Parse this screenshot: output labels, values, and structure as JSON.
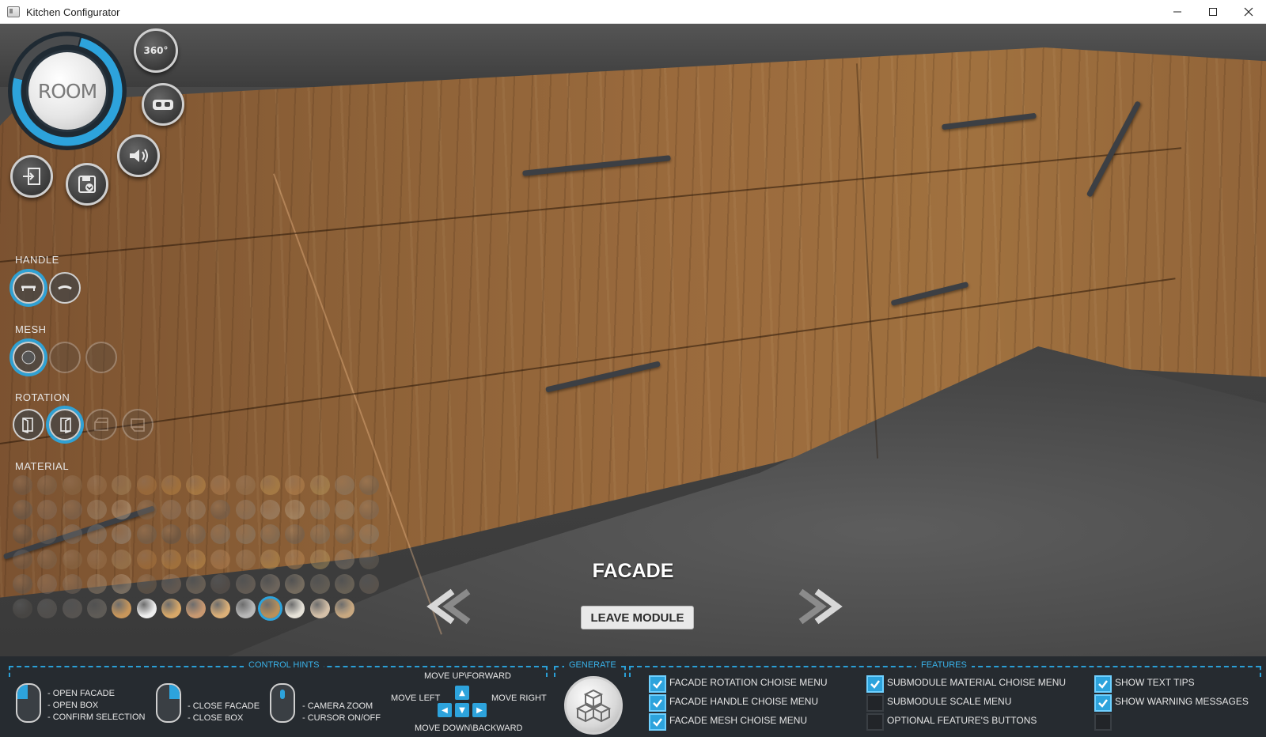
{
  "window": {
    "title": "Kitchen Configurator",
    "minimize_icon": "minimize-icon",
    "maximize_icon": "maximize-icon",
    "close_icon": "close-icon"
  },
  "top_controls": {
    "room_label": "ROOM",
    "btn_360_label": "360°",
    "vr_icon": "vr-headset-icon",
    "sound_icon": "speaker-icon",
    "exit_icon": "exit-icon",
    "save_icon": "save-icon"
  },
  "sections": {
    "handle": "HANDLE",
    "mesh": "MESH",
    "rotation": "ROTATION",
    "material": "MATERIAL"
  },
  "facade": {
    "title": "FACADE",
    "leave_module": "LEAVE MODULE"
  },
  "bottom": {
    "control_hints_title": "CONTROL HINTS",
    "generate_title": "GENERATE",
    "features_title": "FEATURES",
    "hint_left_click": "- OPEN FACADE\n- OPEN BOX\n- CONFIRM SELECTION",
    "hint_right_click": "- CLOSE FACADE\n- CLOSE BOX",
    "hint_wheel": "- CAMERA ZOOM\n- CURSOR ON/OFF",
    "move_up": "MOVE UP\\FORWARD",
    "move_left": "MOVE LEFT",
    "move_right": "MOVE RIGHT",
    "move_down": "MOVE DOWN\\BACKWARD",
    "features": [
      {
        "label": "FACADE ROTATION CHOISE MENU",
        "checked": true
      },
      {
        "label": "FACADE HANDLE CHOISE MENU",
        "checked": true
      },
      {
        "label": "FACADE MESH CHOISE MENU",
        "checked": true
      },
      {
        "label": "SUBMODULE MATERIAL CHOISE MENU",
        "checked": true
      },
      {
        "label": "SUBMODULE SCALE MENU",
        "checked": false
      },
      {
        "label": "OPTIONAL FEATURE'S BUTTONS",
        "checked": false
      },
      {
        "label": "SHOW TEXT TIPS",
        "checked": true
      },
      {
        "label": "SHOW WARNING MESSAGES",
        "checked": true
      },
      {
        "label": "",
        "checked": false
      }
    ]
  },
  "colors": {
    "accent": "#2da3dc",
    "panel_bg": "#262b30",
    "wood": "#9b6b3d"
  }
}
